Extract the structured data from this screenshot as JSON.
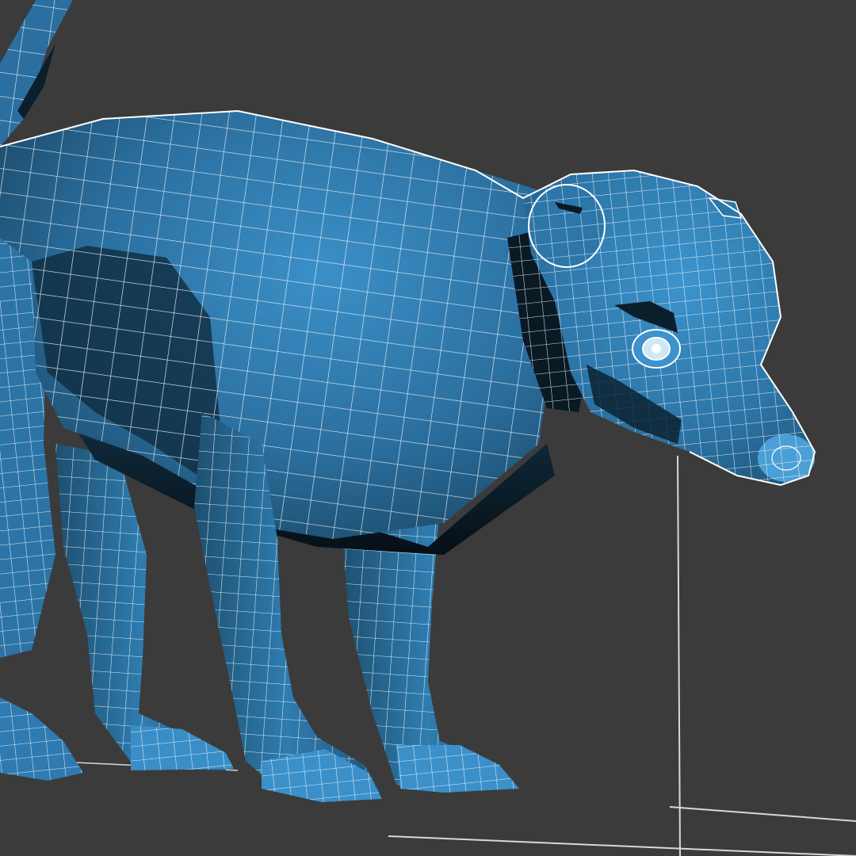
{
  "viewport": {
    "background": "#3b3b3b",
    "grid_line_color": "#d8d8d8"
  },
  "model": {
    "subject": "quadruped-wireframe-mesh",
    "fill_light": "#3a8ac4",
    "fill_mid": "#2a6e9e",
    "fill_dark": "#0f2c40",
    "wire_color": "#ffffff"
  }
}
